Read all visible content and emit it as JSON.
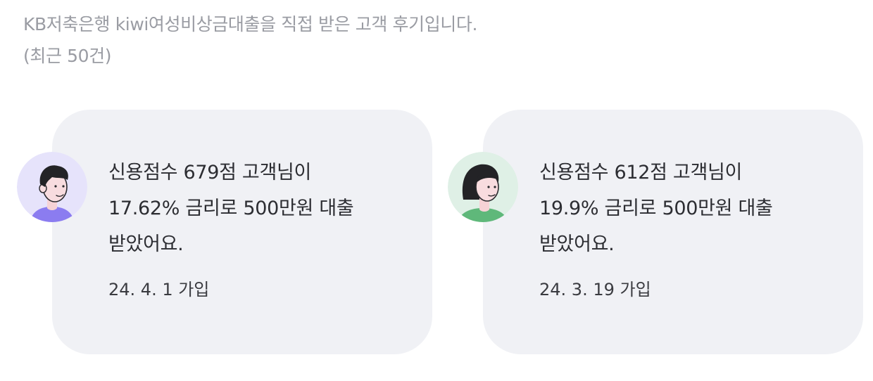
{
  "intro": {
    "line1": "KB저축은행 kiwi여성비상금대출을 직접 받은 고객 후기입니다.",
    "line2": "(최근 50건)"
  },
  "reviews": [
    {
      "line1": "신용점수 679점 고객님이",
      "line2": "17.62% 금리로 500만원 대출",
      "line3": "받았어요.",
      "date": "24. 4. 1 가입",
      "avatar": "male-customer-avatar",
      "avatar_bg": "#e6e3fb",
      "shirt_color": "#8b7cf0"
    },
    {
      "line1": "신용점수 612점 고객님이",
      "line2": "19.9% 금리로 500만원 대출",
      "line3": "받았어요.",
      "date": "24. 3. 19 가입",
      "avatar": "female-customer-avatar",
      "avatar_bg": "#dff0e6",
      "shirt_color": "#5fb87a"
    }
  ]
}
